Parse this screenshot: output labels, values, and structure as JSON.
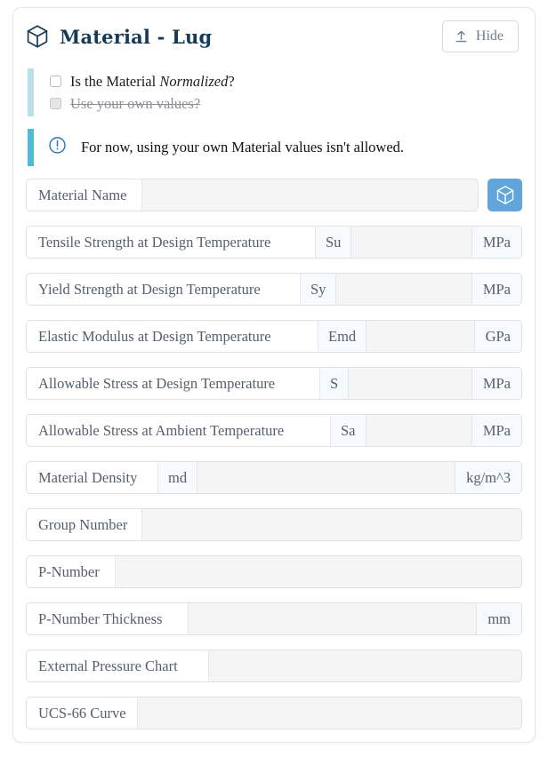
{
  "header": {
    "title": "Material - Lug",
    "icon": "cube-icon",
    "hide_button": {
      "label": "Hide",
      "icon": "upload-arrow-icon"
    }
  },
  "checkboxes": [
    {
      "label_prefix": "Is the Material ",
      "label_em": "Normalized",
      "label_suffix": "?",
      "checked": false,
      "disabled": false
    },
    {
      "label_prefix": "Use your own values?",
      "label_em": "",
      "label_suffix": "",
      "checked": false,
      "disabled": true
    }
  ],
  "alert": {
    "icon": "exclamation-circle-icon",
    "text": "For now, using your own Material values isn't allowed.",
    "accent_color": "#4cbcd8"
  },
  "colors": {
    "title": "#173a56",
    "cube_button": "#61a5dd",
    "checkbox_bar": "#b9dfe8",
    "label_text": "#55606e"
  },
  "fields": [
    {
      "label": "Material Name",
      "symbol": "",
      "value": "",
      "unit": "",
      "has_cube_button": true,
      "label_width": 130
    },
    {
      "label": "Tensile Strength at Design Temperature",
      "symbol": "Su",
      "value": "",
      "unit": "MPa",
      "has_cube_button": false,
      "label_width": 325
    },
    {
      "label": "Yield Strength at Design Temperature",
      "symbol": "Sy",
      "value": "",
      "unit": "MPa",
      "has_cube_button": false,
      "label_width": 308
    },
    {
      "label": "Elastic Modulus at Design Temperature",
      "symbol": "Emd",
      "value": "",
      "unit": "GPa",
      "has_cube_button": false,
      "label_width": 328
    },
    {
      "label": "Allowable Stress at Design Temperature",
      "symbol": "S",
      "value": "",
      "unit": "MPa",
      "has_cube_button": false,
      "label_width": 330
    },
    {
      "label": "Allowable Stress at Ambient Temperature",
      "symbol": "Sa",
      "value": "",
      "unit": "MPa",
      "has_cube_button": false,
      "label_width": 342
    },
    {
      "label": "Material Density",
      "symbol": "md",
      "value": "",
      "unit": "kg/m^3",
      "has_cube_button": false,
      "label_width": 148
    },
    {
      "label": "Group Number",
      "symbol": "",
      "value": "",
      "unit": "",
      "has_cube_button": false,
      "label_width": 130
    },
    {
      "label": "P-Number",
      "symbol": "",
      "value": "",
      "unit": "",
      "has_cube_button": false,
      "label_width": 100
    },
    {
      "label": "P-Number Thickness",
      "symbol": "",
      "value": "",
      "unit": "mm",
      "has_cube_button": false,
      "label_width": 182
    },
    {
      "label": "External Pressure Chart",
      "symbol": "",
      "value": "",
      "unit": "",
      "has_cube_button": false,
      "label_width": 205
    },
    {
      "label": "UCS-66 Curve",
      "symbol": "",
      "value": "",
      "unit": "",
      "has_cube_button": false,
      "label_width": 125
    }
  ]
}
